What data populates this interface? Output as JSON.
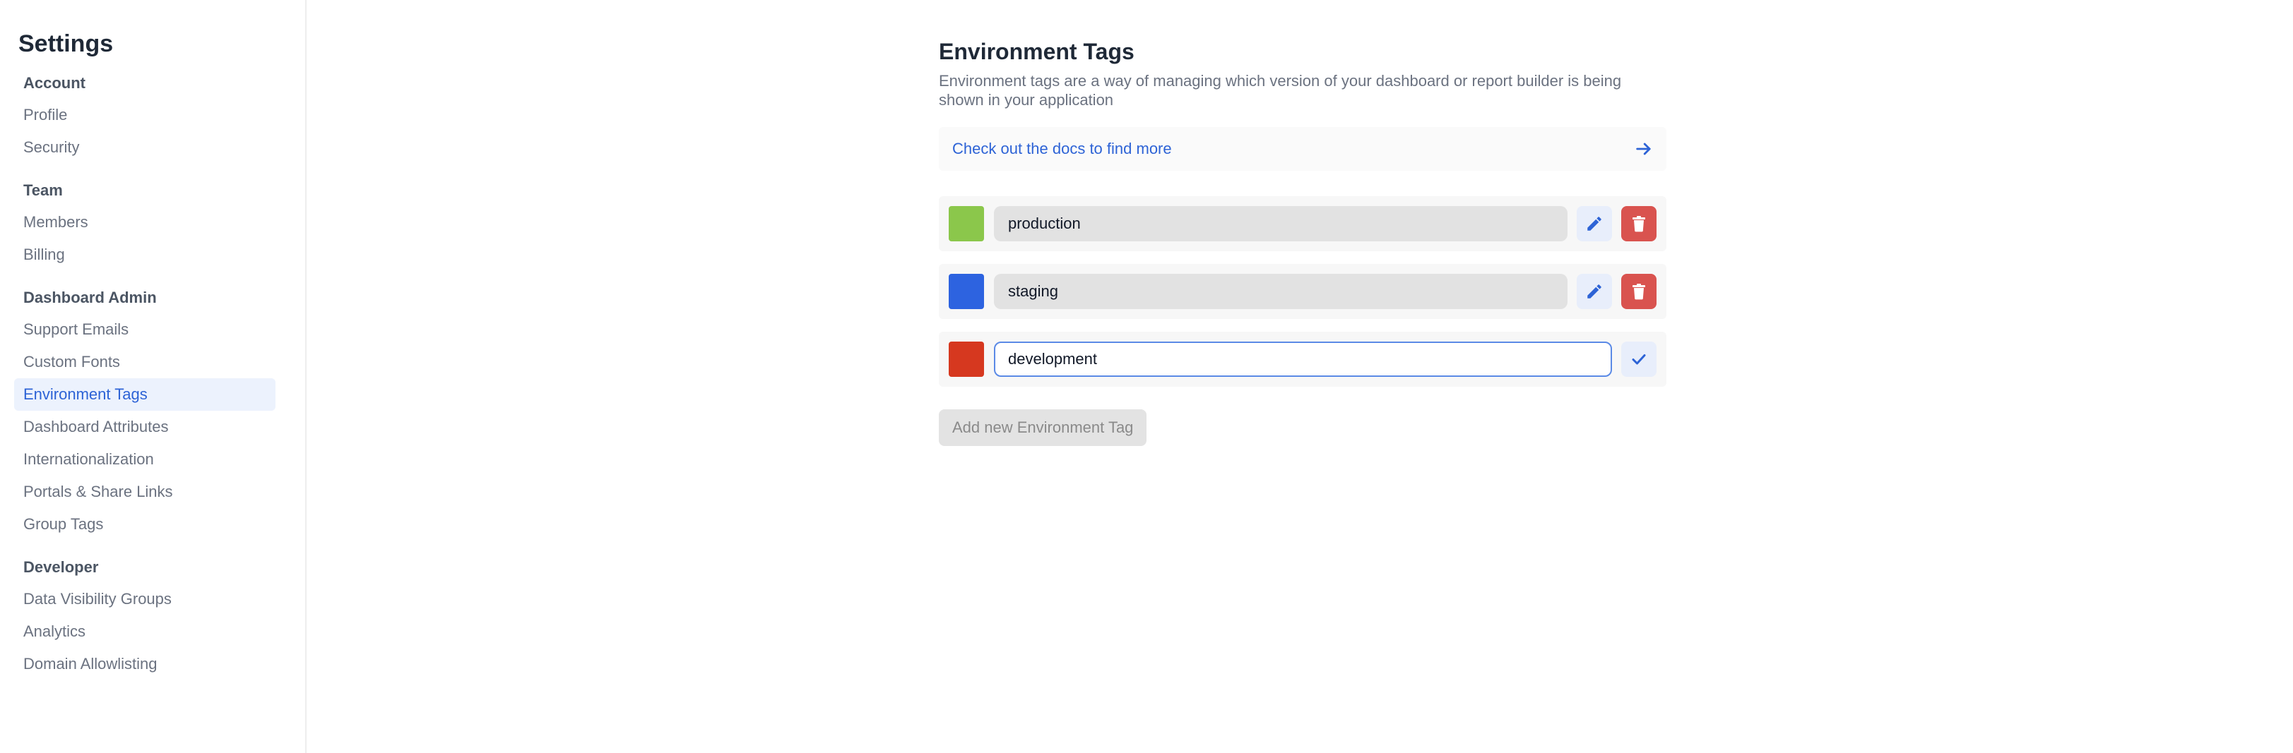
{
  "sidebar": {
    "title": "Settings",
    "groups": [
      {
        "heading": "Account",
        "items": [
          {
            "label": "Profile"
          },
          {
            "label": "Security"
          }
        ]
      },
      {
        "heading": "Team",
        "items": [
          {
            "label": "Members"
          },
          {
            "label": "Billing"
          }
        ]
      },
      {
        "heading": "Dashboard Admin",
        "items": [
          {
            "label": "Support Emails"
          },
          {
            "label": "Custom Fonts"
          },
          {
            "label": "Environment Tags",
            "active": true
          },
          {
            "label": "Dashboard Attributes"
          },
          {
            "label": "Internationalization"
          },
          {
            "label": "Portals & Share Links"
          },
          {
            "label": "Group Tags"
          }
        ]
      },
      {
        "heading": "Developer",
        "items": [
          {
            "label": "Data Visibility Groups"
          },
          {
            "label": "Analytics"
          },
          {
            "label": "Domain Allowlisting"
          }
        ]
      }
    ]
  },
  "main": {
    "title": "Environment Tags",
    "description": "Environment tags are a way of managing which version of your dashboard or report builder is being shown in your application",
    "docs_link": {
      "label": "Check out the docs to find more",
      "icon": "arrow-right-icon"
    },
    "tags": [
      {
        "name": "production",
        "color": "#8bc74b",
        "state": "saved"
      },
      {
        "name": "staging",
        "color": "#2d63e0",
        "state": "saved"
      },
      {
        "name": "development",
        "color": "#d6381f",
        "state": "editing"
      }
    ],
    "add_button_label": "Add new Environment Tag"
  },
  "colors": {
    "accent": "#2d63d6",
    "active_nav_bg": "#ecf2fd",
    "delete": "#d9534f"
  }
}
